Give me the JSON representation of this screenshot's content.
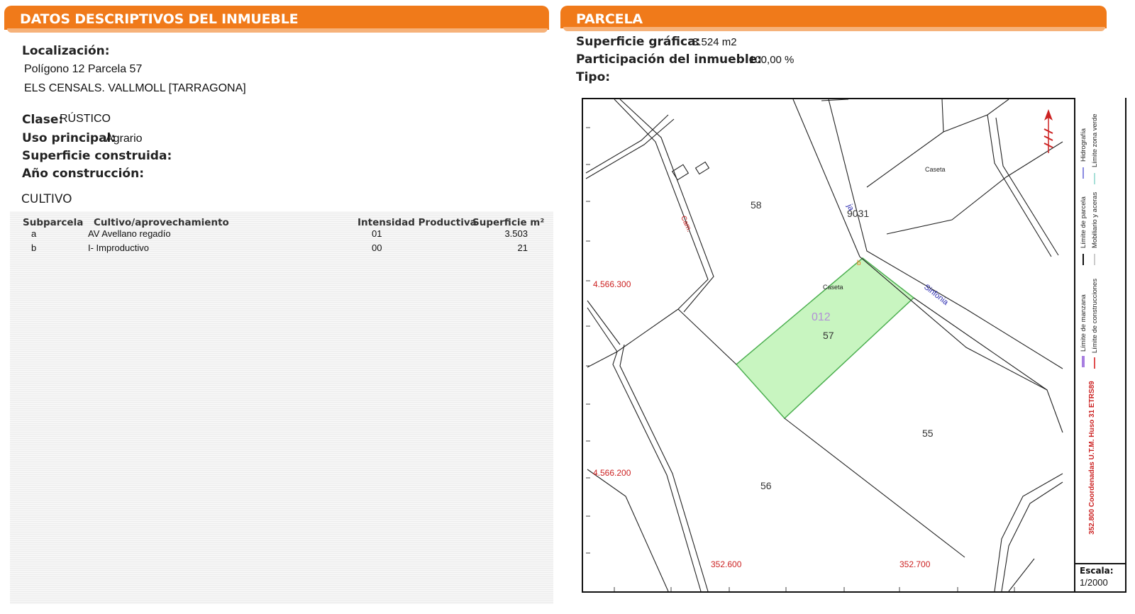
{
  "left_header": "DATOS DESCRIPTIVOS DEL INMUEBLE",
  "right_header": "PARCELA",
  "localizacion": {
    "label": "Localización:",
    "line1": "Polígono 12 Parcela 57",
    "line2": "ELS CENSALS. VALLMOLL [TARRAGONA]"
  },
  "clase": {
    "label": "Clase:",
    "value": "RÚSTICO"
  },
  "uso": {
    "label": "Uso principal:",
    "value": "Agrario"
  },
  "superficie_construida": {
    "label": "Superficie construida:"
  },
  "anio": {
    "label": "Año construcción:"
  },
  "cultivo": {
    "title": "CULTIVO",
    "headers": [
      "Subparcela",
      "Cultivo/aprovechamiento",
      "Intensidad Productiva",
      "Superficie m²"
    ],
    "rows": [
      [
        "a",
        "AV Avellano regadío",
        "01",
        "3.503"
      ],
      [
        "b",
        "I- Improductivo",
        "00",
        "21"
      ]
    ]
  },
  "parcela": {
    "superficie_label": "Superficie gráfica:",
    "superficie_value": "3.524 m2",
    "participacion_label": "Participación del inmueble:",
    "participacion_value": "100,00 %",
    "tipo_label": "Tipo:"
  },
  "map": {
    "parcel_numbers": [
      "58",
      "9031",
      "57",
      "55",
      "56"
    ],
    "zone_code": "012",
    "caseta_labels": [
      "Caseta",
      "Caseta"
    ],
    "road_labels": [
      "Sinfonia",
      "Cam.",
      "ja"
    ],
    "subparcel_mark": "b",
    "coords_y": [
      "4.566.300",
      "4.566.200"
    ],
    "coords_x": [
      "352.600",
      "352.700"
    ],
    "vertical_coord_text": "352.800 Coordenadas U.T.M. Huso 31 ETRS89",
    "legend": [
      "Límite de manzana",
      "Límite de parcela",
      "Hidrografía",
      "Límite de construcciones",
      "Mobiliario y aceras",
      "Límite zona verde"
    ],
    "scale_label": "Escala:",
    "scale_value": "1/2000",
    "colors": {
      "parcel_fill": "#c8f5c0",
      "parcel_line": "#4caf50",
      "coord_red": "#cc2222",
      "label_blue": "#2a2ab0",
      "zone_purple": "#b28fd6"
    }
  }
}
